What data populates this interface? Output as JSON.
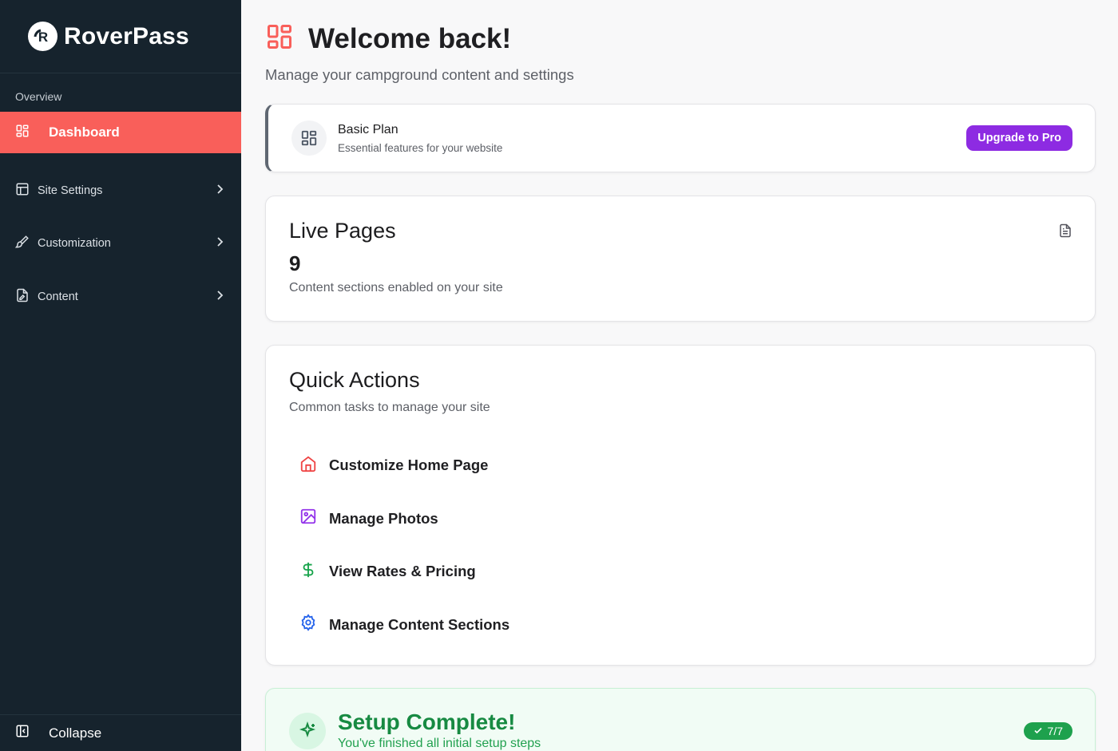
{
  "brand": {
    "name": "RoverPass"
  },
  "sidebar": {
    "section_label": "Overview",
    "active_item": {
      "label": "Dashboard",
      "icon": "dashboard-grid-icon"
    },
    "items": [
      {
        "label": "Site Settings",
        "icon": "layout-icon"
      },
      {
        "label": "Customization",
        "icon": "paintbrush-icon"
      },
      {
        "label": "Content",
        "icon": "file-edit-icon"
      }
    ],
    "collapse_label": "Collapse"
  },
  "header": {
    "title": "Welcome back!",
    "subtitle": "Manage your campground content and settings"
  },
  "plan": {
    "name": "Basic Plan",
    "description": "Essential features for your website",
    "upgrade_label": "Upgrade to Pro"
  },
  "live_pages": {
    "title": "Live Pages",
    "count": "9",
    "description": "Content sections enabled on your site"
  },
  "quick_actions": {
    "title": "Quick Actions",
    "subtitle": "Common tasks to manage your site",
    "items": [
      {
        "label": "Customize Home Page",
        "icon": "home-icon",
        "color": "#ef4444"
      },
      {
        "label": "Manage Photos",
        "icon": "image-icon",
        "color": "#9333ea"
      },
      {
        "label": "View Rates & Pricing",
        "icon": "dollar-icon",
        "color": "#16a34a"
      },
      {
        "label": "Manage Content Sections",
        "icon": "gear-icon",
        "color": "#2563eb"
      }
    ]
  },
  "setup": {
    "title": "Setup Complete!",
    "subtitle": "You've finished all initial setup steps",
    "badge": "7/7"
  },
  "colors": {
    "sidebar_bg": "#16232d",
    "accent_red": "#f95f5a",
    "upgrade_purple": "#8d2be2",
    "success_green": "#1ea14d"
  }
}
